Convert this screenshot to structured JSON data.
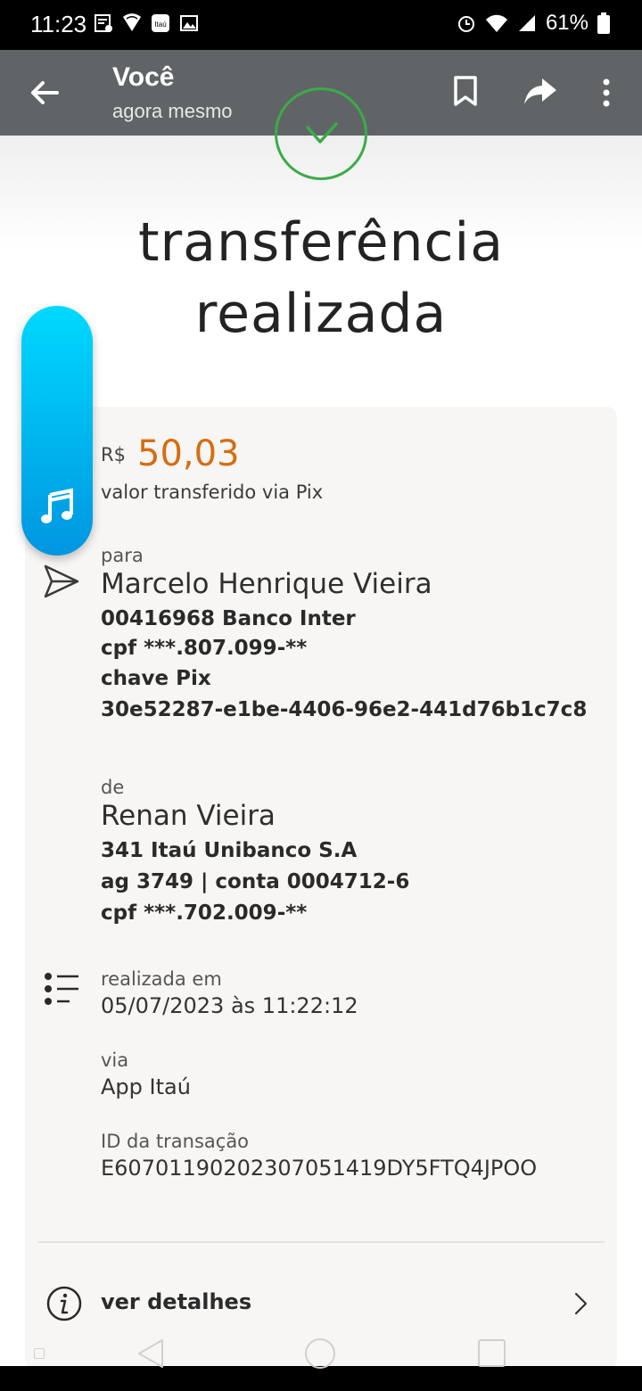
{
  "status_bar": {
    "time": "11:23",
    "battery": "61%"
  },
  "app_bar": {
    "title": "Você",
    "subtitle": "agora mesmo"
  },
  "headline": {
    "line1": "transferência",
    "line2": "realizada"
  },
  "amount": {
    "currency": "R$",
    "value": "50,03",
    "caption": "valor transferido via Pix",
    "color": "#d56d12"
  },
  "recipient": {
    "label": "para",
    "name": "Marcelo Henrique Vieira",
    "bank": "00416968 Banco Inter",
    "cpf": "cpf ***.807.099-**",
    "key_label": "chave Pix",
    "key": "30e52287-e1be-4406-96e2-441d76b1c7c8"
  },
  "sender": {
    "label": "de",
    "name": "Renan Vieira",
    "bank": "341 Itaú Unibanco S.A",
    "account": "ag 3749 | conta 0004712-6",
    "cpf": "cpf ***.702.009-**"
  },
  "info": {
    "date_label": "realizada em",
    "date_value": "05/07/2023 às 11:22:12",
    "via_label": "via",
    "via_value": "App Itaú",
    "id_label": "ID da transação",
    "id_value": "E60701190202307051419DY5FTQ4JPOO"
  },
  "details_link": "ver detalhes",
  "icons": {
    "back": "arrow-left-icon",
    "bookmark": "bookmark-icon",
    "share": "share-icon",
    "more": "more-vert-icon",
    "success": "check-circle-icon",
    "music": "music-note-icon",
    "send": "send-icon",
    "list": "list-icon",
    "info": "info-icon",
    "chevron": "chevron-right-icon"
  },
  "colors": {
    "app_bar": "#616466",
    "success": "#3bab4a",
    "amount": "#d56d12",
    "widget": "#00c2f5"
  }
}
